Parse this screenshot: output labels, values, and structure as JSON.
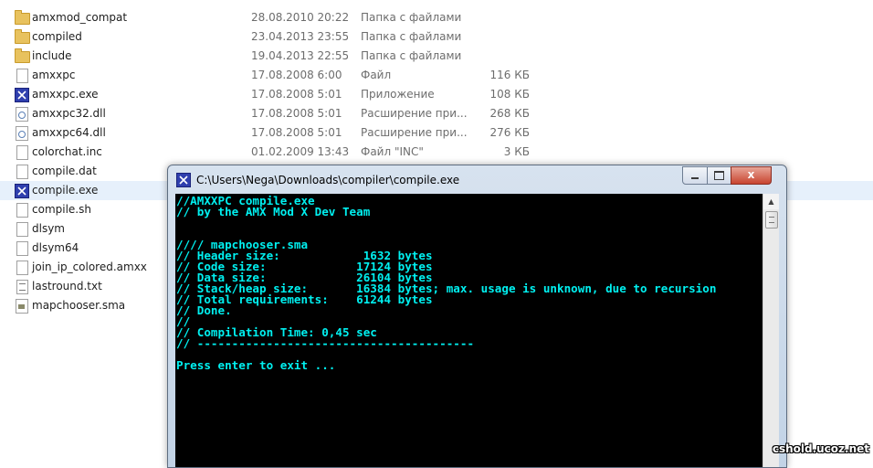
{
  "files": [
    {
      "name": "amxmod_compat",
      "date": "28.08.2010 20:22",
      "type": "Папка с файлами",
      "size": "",
      "icon": "folder-icon"
    },
    {
      "name": "compiled",
      "date": "23.04.2013 23:55",
      "type": "Папка с файлами",
      "size": "",
      "icon": "folder-icon"
    },
    {
      "name": "include",
      "date": "19.04.2013 22:55",
      "type": "Папка с файлами",
      "size": "",
      "icon": "folder-icon"
    },
    {
      "name": "amxxpc",
      "date": "17.08.2008 6:00",
      "type": "Файл",
      "size": "116 КБ",
      "icon": "file-icon"
    },
    {
      "name": "amxxpc.exe",
      "date": "17.08.2008 5:01",
      "type": "Приложение",
      "size": "108 КБ",
      "icon": "exe-icon"
    },
    {
      "name": "amxxpc32.dll",
      "date": "17.08.2008 5:01",
      "type": "Расширение при...",
      "size": "268 КБ",
      "icon": "dll-icon"
    },
    {
      "name": "amxxpc64.dll",
      "date": "17.08.2008 5:01",
      "type": "Расширение при...",
      "size": "276 КБ",
      "icon": "dll-icon"
    },
    {
      "name": "colorchat.inc",
      "date": "01.02.2009 13:43",
      "type": "Файл \"INC\"",
      "size": "3 КБ",
      "icon": "file-icon"
    },
    {
      "name": "compile.dat",
      "date": "",
      "type": "",
      "size": "",
      "icon": "file-icon"
    },
    {
      "name": "compile.exe",
      "date": "",
      "type": "",
      "size": "",
      "icon": "exe-icon",
      "selected": true
    },
    {
      "name": "compile.sh",
      "date": "",
      "type": "",
      "size": "",
      "icon": "file-icon"
    },
    {
      "name": "dlsym",
      "date": "",
      "type": "",
      "size": "",
      "icon": "file-icon"
    },
    {
      "name": "dlsym64",
      "date": "",
      "type": "",
      "size": "",
      "icon": "file-icon"
    },
    {
      "name": "join_ip_colored.amxx",
      "date": "",
      "type": "",
      "size": "",
      "icon": "file-icon"
    },
    {
      "name": "lastround.txt",
      "date": "",
      "type": "",
      "size": "",
      "icon": "txt-icon"
    },
    {
      "name": "mapchooser.sma",
      "date": "",
      "type": "",
      "size": "",
      "icon": "sma-icon"
    }
  ],
  "console_window": {
    "title": "C:\\Users\\Nega\\Downloads\\compiler\\compile.exe",
    "close_glyph": "x",
    "scroll_up_glyph": "▲",
    "text_color": "#00f0f0",
    "lines": [
      "//AMXXPC compile.exe",
      "// by the AMX Mod X Dev Team",
      "",
      "",
      "//// mapchooser.sma",
      "// Header size:            1632 bytes",
      "// Code size:             17124 bytes",
      "// Data size:             26104 bytes",
      "// Stack/heap size:       16384 bytes; max. usage is unknown, due to recursion",
      "// Total requirements:    61244 bytes",
      "// Done.",
      "//",
      "// Compilation Time: 0,45 sec",
      "// ----------------------------------------",
      "",
      "Press enter to exit ..."
    ]
  },
  "watermark": "cshold.ucoz.net"
}
